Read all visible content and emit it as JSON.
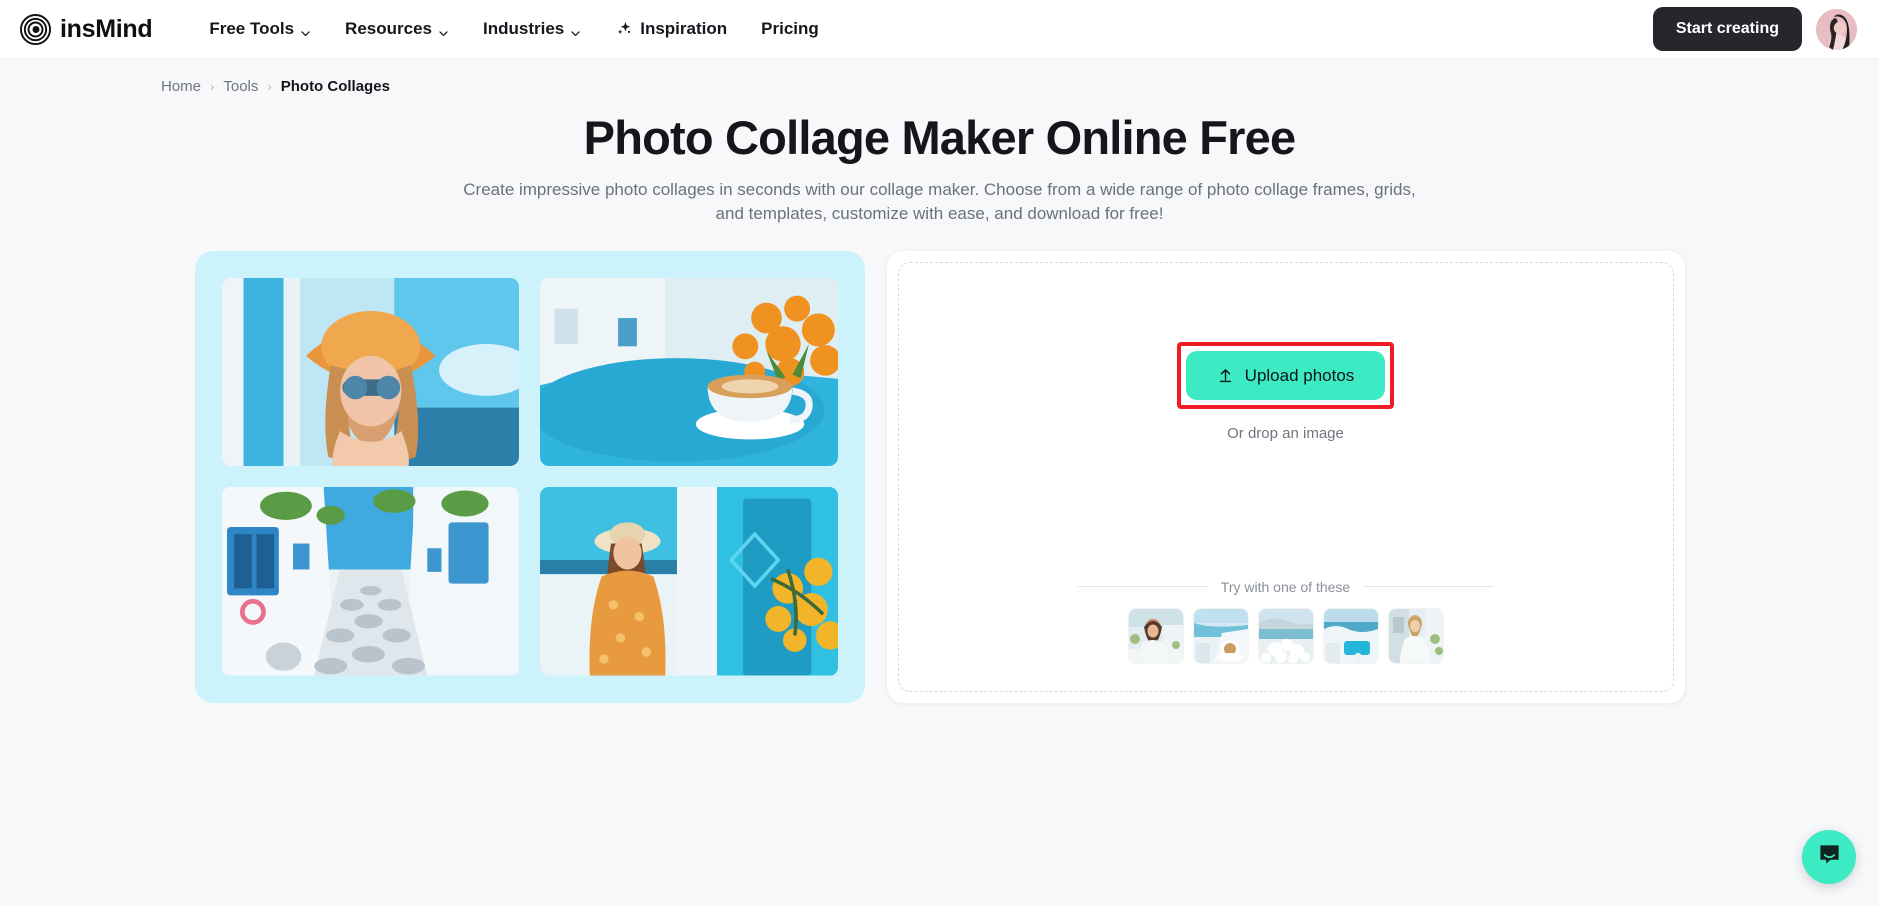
{
  "header": {
    "brand": "insMind",
    "brand_icon": "insmind-spiral-logo",
    "nav": [
      {
        "label": "Free Tools",
        "caret": true,
        "icon": null
      },
      {
        "label": "Resources",
        "caret": true,
        "icon": null
      },
      {
        "label": "Industries",
        "caret": true,
        "icon": null
      },
      {
        "label": "Inspiration",
        "caret": false,
        "icon": "sparkle-icon"
      },
      {
        "label": "Pricing",
        "caret": false,
        "icon": null
      }
    ],
    "start_button": "Start creating",
    "avatar_icon": "user-avatar"
  },
  "breadcrumb": {
    "items": [
      "Home",
      "Tools",
      "Photo Collages"
    ],
    "separator": "›"
  },
  "hero": {
    "title": "Photo Collage Maker Online Free",
    "subtitle": "Create impressive photo collages in seconds with our collage maker. Choose from a wide range of photo collage frames, grids, and templates, customize with ease, and download for free!"
  },
  "collage": {
    "background_color": "#ccf3fb",
    "tiles": [
      {
        "name": "woman-in-straw-hat-sunglasses",
        "alt": "Woman in orange floral straw hat with sunglasses by a blue wall"
      },
      {
        "name": "coffee-cup-with-orange-flowers",
        "alt": "Cappuccino cup on a blue table with orange flowers"
      },
      {
        "name": "white-blue-alley-street",
        "alt": "Whitewashed Greek alley with blue doors"
      },
      {
        "name": "woman-in-orange-dress-doorway",
        "alt": "Woman in orange dress beside a blue door with yellow flowers"
      }
    ]
  },
  "upload": {
    "button_label": "Upload photos",
    "button_icon": "upload-arrow-icon",
    "button_color": "#3cebc3",
    "highlight_color": "#ee1c25",
    "drop_hint": "Or drop an image",
    "try_label": "Try with one of these",
    "samples": [
      {
        "name": "sample-woman-white-dress"
      },
      {
        "name": "sample-coffee-seaside-terrace"
      },
      {
        "name": "sample-white-flowers-sea-view"
      },
      {
        "name": "sample-blue-pool-village"
      },
      {
        "name": "sample-woman-in-gown-stairs"
      }
    ]
  },
  "chat": {
    "icon": "chat-bubble-icon",
    "color": "#3cebc3"
  }
}
